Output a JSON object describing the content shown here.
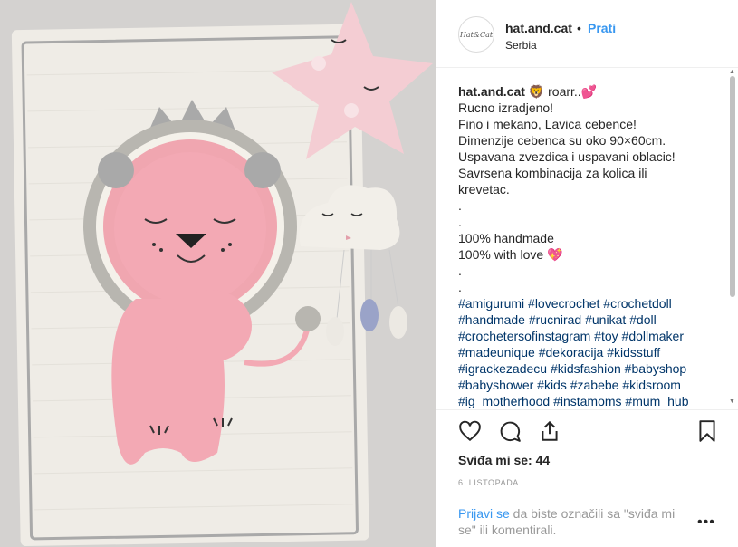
{
  "photo": {
    "alt": ""
  },
  "header": {
    "avatar_text": "Hat&Cat",
    "username": "hat.and.cat",
    "dot": "•",
    "follow_label": "Prati",
    "location": "Serbia"
  },
  "caption": {
    "username": "hat.and.cat",
    "line1": " 🦁 roarr..💕",
    "lines": [
      "Rucno izradjeno!",
      "Fino i mekano, Lavica cebence!",
      "Dimenzije cebenca su oko 90×60cm.",
      "Uspavana zvezdica i uspavani oblacic!",
      "Savrsena kombinacija za kolica ili",
      "krevetac.",
      ".",
      ".",
      "100% handmade",
      "100% with love 💖",
      ".",
      "."
    ],
    "hashtags": [
      "#amigurumi #lovecrochet #crochetdoll",
      "#handmade #rucnirad #unikat #doll",
      "#crochetersofinstagram #toy #dollmaker",
      "#madeunique #dekoracija #kidsstuff",
      "#igrackezadecu #kidsfashion #babyshop",
      "#babyshower #kids #zabebe #kidsroom",
      "#ig_motherhood #instamoms #mum_hub"
    ]
  },
  "actions": {
    "like_icon": "heart-icon",
    "comment_icon": "comment-icon",
    "share_icon": "share-icon",
    "save_icon": "bookmark-icon"
  },
  "likes": "Sviđa mi se: 44",
  "date": "6. LISTOPADA",
  "login": {
    "link": "Prijavi se",
    "text": " da biste označili sa \"sviđa mi se\" ili komentirali."
  },
  "more": "•••",
  "colors": {
    "accent": "#3897f0",
    "hashtag": "#003569",
    "muted": "#999999"
  }
}
